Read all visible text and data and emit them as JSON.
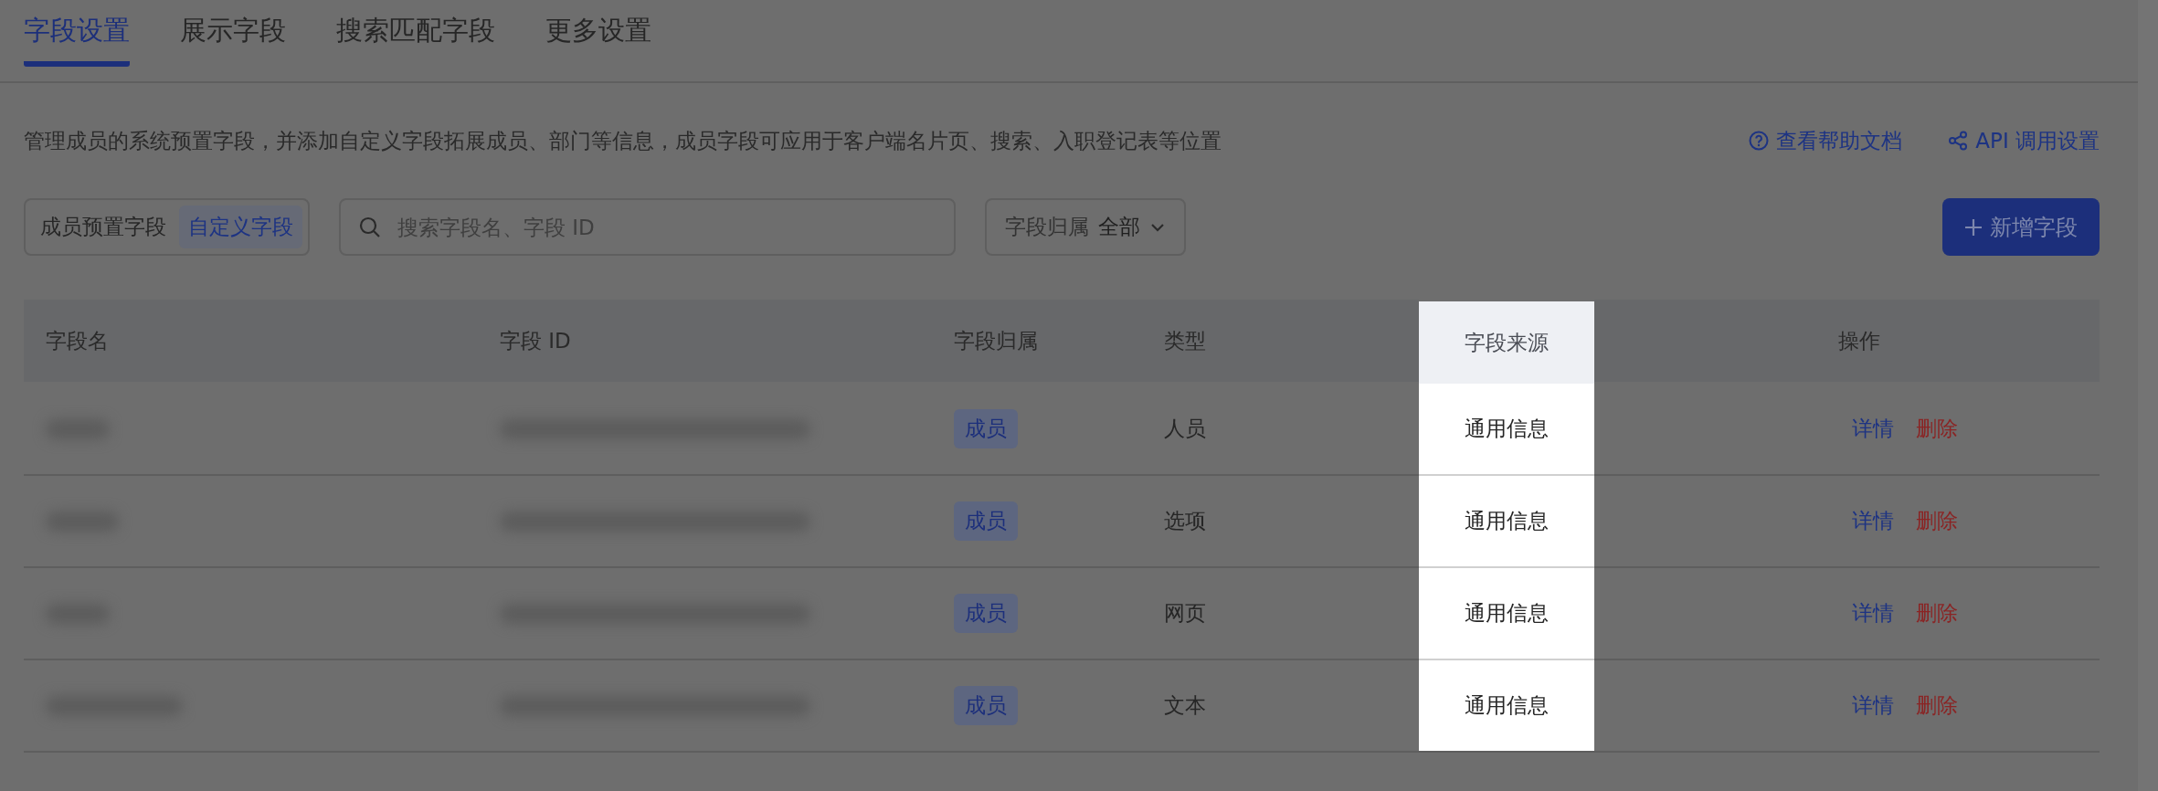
{
  "tabs": [
    {
      "label": "字段设置",
      "selected": true
    },
    {
      "label": "展示字段",
      "selected": false
    },
    {
      "label": "搜索匹配字段",
      "selected": false
    },
    {
      "label": "更多设置",
      "selected": false
    }
  ],
  "description": "管理成员的系统预置字段，并添加自定义字段拓展成员、部门等信息，成员字段可应用于客户端名片页、搜索、入职登记表等位置",
  "links": [
    {
      "kind": "help",
      "label": "查看帮助文档"
    },
    {
      "kind": "api",
      "label": "API 调用设置"
    }
  ],
  "segments": [
    {
      "label": "成员预置字段",
      "selected": false
    },
    {
      "label": "自定义字段",
      "selected": true
    }
  ],
  "search": {
    "placeholder": "搜索字段名、字段 ID"
  },
  "filter": {
    "label": "字段归属",
    "value": "全部"
  },
  "add_button": "新增字段",
  "table": {
    "columns": [
      {
        "label": "字段名",
        "highlighted": false
      },
      {
        "label": "字段 ID",
        "highlighted": false
      },
      {
        "label": "字段归属",
        "highlighted": false
      },
      {
        "label": "类型",
        "highlighted": false
      },
      {
        "label": "字段来源",
        "highlighted": true
      },
      {
        "label": "操作",
        "highlighted": false
      }
    ],
    "rows": [
      {
        "owner": "成员",
        "type": "人员",
        "source": "通用信息",
        "actions": [
          {
            "kind": "detail",
            "label": "详情"
          },
          {
            "kind": "delete",
            "label": "删除"
          }
        ]
      },
      {
        "owner": "成员",
        "type": "选项",
        "source": "通用信息",
        "actions": [
          {
            "kind": "detail",
            "label": "详情"
          },
          {
            "kind": "delete",
            "label": "删除"
          }
        ]
      },
      {
        "owner": "成员",
        "type": "网页",
        "source": "通用信息",
        "actions": [
          {
            "kind": "detail",
            "label": "详情"
          },
          {
            "kind": "delete",
            "label": "删除"
          }
        ]
      },
      {
        "owner": "成员",
        "type": "文本",
        "source": "通用信息",
        "actions": [
          {
            "kind": "detail",
            "label": "详情"
          },
          {
            "kind": "delete",
            "label": "删除"
          }
        ]
      }
    ]
  }
}
